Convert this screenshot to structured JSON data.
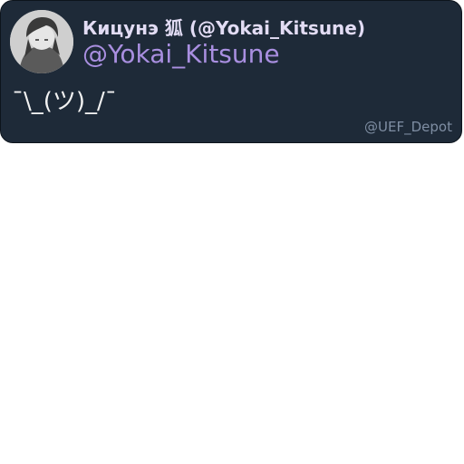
{
  "quote_card": {
    "avatar_icon": "user-avatar-icon",
    "display_name": "Кицунэ 狐 (@Yokai_Kitsune)",
    "handle": "@Yokai_Kitsune",
    "message": "¯\\_(ツ)_/¯",
    "watermark": "@UEF_Depot",
    "colors": {
      "card_background": "#1e2a38",
      "display_name": "#e2dcf4",
      "handle": "#a98fe0",
      "message": "#f2f2f2",
      "watermark": "#7f8ea3"
    }
  }
}
